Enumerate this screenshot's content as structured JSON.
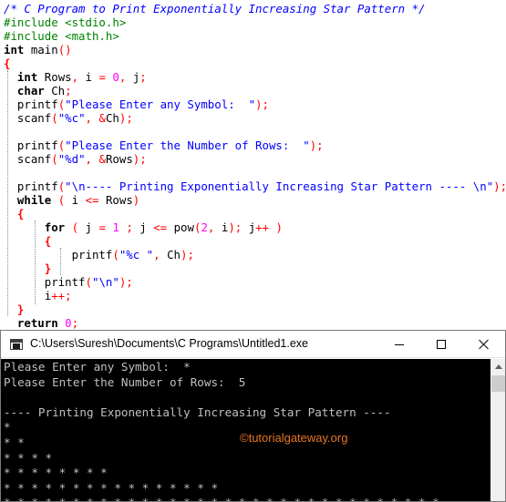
{
  "editor": {
    "lines": [
      [
        [
          "comment",
          "/* C Program to Print Exponentially Increasing Star Pattern */"
        ]
      ],
      [
        [
          "pp",
          "#include <stdio.h>"
        ]
      ],
      [
        [
          "pp",
          "#include <math.h>"
        ]
      ],
      [
        [
          "kw",
          "int"
        ],
        [
          "plain",
          " main"
        ],
        [
          "punct",
          "()"
        ]
      ],
      [
        [
          "brace",
          "{"
        ]
      ],
      [
        [
          "plain",
          "  "
        ],
        [
          "kw",
          "int"
        ],
        [
          "plain",
          " Rows"
        ],
        [
          "punct",
          ","
        ],
        [
          "plain",
          " i "
        ],
        [
          "punct",
          "="
        ],
        [
          "plain",
          " "
        ],
        [
          "num",
          "0"
        ],
        [
          "punct",
          ","
        ],
        [
          "plain",
          " j"
        ],
        [
          "punct",
          ";"
        ]
      ],
      [
        [
          "plain",
          "  "
        ],
        [
          "kw",
          "char"
        ],
        [
          "plain",
          " Ch"
        ],
        [
          "punct",
          ";"
        ]
      ],
      [
        [
          "plain",
          "  printf"
        ],
        [
          "punct",
          "("
        ],
        [
          "str",
          "\"Please Enter any Symbol:  \""
        ],
        [
          "punct",
          ");"
        ]
      ],
      [
        [
          "plain",
          "  scanf"
        ],
        [
          "punct",
          "("
        ],
        [
          "str",
          "\"%c\""
        ],
        [
          "punct",
          ","
        ],
        [
          "plain",
          " "
        ],
        [
          "punct",
          "&"
        ],
        [
          "plain",
          "Ch"
        ],
        [
          "punct",
          ");"
        ]
      ],
      [],
      [
        [
          "plain",
          "  printf"
        ],
        [
          "punct",
          "("
        ],
        [
          "str",
          "\"Please Enter the Number of Rows:  \""
        ],
        [
          "punct",
          ");"
        ]
      ],
      [
        [
          "plain",
          "  scanf"
        ],
        [
          "punct",
          "("
        ],
        [
          "str",
          "\"%d\""
        ],
        [
          "punct",
          ","
        ],
        [
          "plain",
          " "
        ],
        [
          "punct",
          "&"
        ],
        [
          "plain",
          "Rows"
        ],
        [
          "punct",
          ");"
        ]
      ],
      [],
      [
        [
          "plain",
          "  printf"
        ],
        [
          "punct",
          "("
        ],
        [
          "str",
          "\"\\n---- Printing Exponentially Increasing Star Pattern ---- \\n\""
        ],
        [
          "punct",
          ");"
        ]
      ],
      [
        [
          "plain",
          "  "
        ],
        [
          "kw",
          "while"
        ],
        [
          "plain",
          " "
        ],
        [
          "punct",
          "("
        ],
        [
          "plain",
          " i "
        ],
        [
          "punct",
          "<="
        ],
        [
          "plain",
          " Rows"
        ],
        [
          "punct",
          ")"
        ]
      ],
      [
        [
          "plain",
          "  "
        ],
        [
          "brace",
          "{"
        ]
      ],
      [
        [
          "plain",
          "      "
        ],
        [
          "kw",
          "for"
        ],
        [
          "plain",
          " "
        ],
        [
          "punct",
          "("
        ],
        [
          "plain",
          " j "
        ],
        [
          "punct",
          "="
        ],
        [
          "plain",
          " "
        ],
        [
          "num",
          "1"
        ],
        [
          "plain",
          " "
        ],
        [
          "punct",
          ";"
        ],
        [
          "plain",
          " j "
        ],
        [
          "punct",
          "<="
        ],
        [
          "plain",
          " pow"
        ],
        [
          "punct",
          "("
        ],
        [
          "num",
          "2"
        ],
        [
          "punct",
          ","
        ],
        [
          "plain",
          " i"
        ],
        [
          "punct",
          ");"
        ],
        [
          "plain",
          " j"
        ],
        [
          "punct",
          "++"
        ],
        [
          "plain",
          " "
        ],
        [
          "punct",
          ")"
        ]
      ],
      [
        [
          "plain",
          "      "
        ],
        [
          "brace",
          "{"
        ]
      ],
      [
        [
          "plain",
          "          printf"
        ],
        [
          "punct",
          "("
        ],
        [
          "str",
          "\"%c \""
        ],
        [
          "punct",
          ","
        ],
        [
          "plain",
          " Ch"
        ],
        [
          "punct",
          ");"
        ]
      ],
      [
        [
          "plain",
          "      "
        ],
        [
          "brace",
          "}"
        ]
      ],
      [
        [
          "plain",
          "      printf"
        ],
        [
          "punct",
          "("
        ],
        [
          "str",
          "\"\\n\""
        ],
        [
          "punct",
          ");"
        ]
      ],
      [
        [
          "plain",
          "      i"
        ],
        [
          "punct",
          "++;"
        ]
      ],
      [
        [
          "plain",
          "  "
        ],
        [
          "brace",
          "}"
        ]
      ],
      [
        [
          "plain",
          "  "
        ],
        [
          "kw",
          "return"
        ],
        [
          "plain",
          " "
        ],
        [
          "num",
          "0"
        ],
        [
          "punct",
          ";"
        ]
      ]
    ]
  },
  "console": {
    "title": "C:\\Users\\Suresh\\Documents\\C Programs\\Untitled1.exe",
    "lines": [
      "Please Enter any Symbol:  *",
      "Please Enter the Number of Rows:  5",
      "",
      "---- Printing Exponentially Increasing Star Pattern ----",
      "*",
      "* *",
      "* * * *",
      "* * * * * * * *",
      "* * * * * * * * * * * * * * * *",
      "* * * * * * * * * * * * * * * * * * * * * * * * * * * * * * * *"
    ],
    "watermark": "©tutorialgateway.org"
  },
  "icons": {
    "app": "console-app-icon",
    "minimize": "minimize-icon",
    "maximize": "maximize-icon",
    "close": "close-icon",
    "scroll_up": "scroll-up-arrow-icon"
  }
}
